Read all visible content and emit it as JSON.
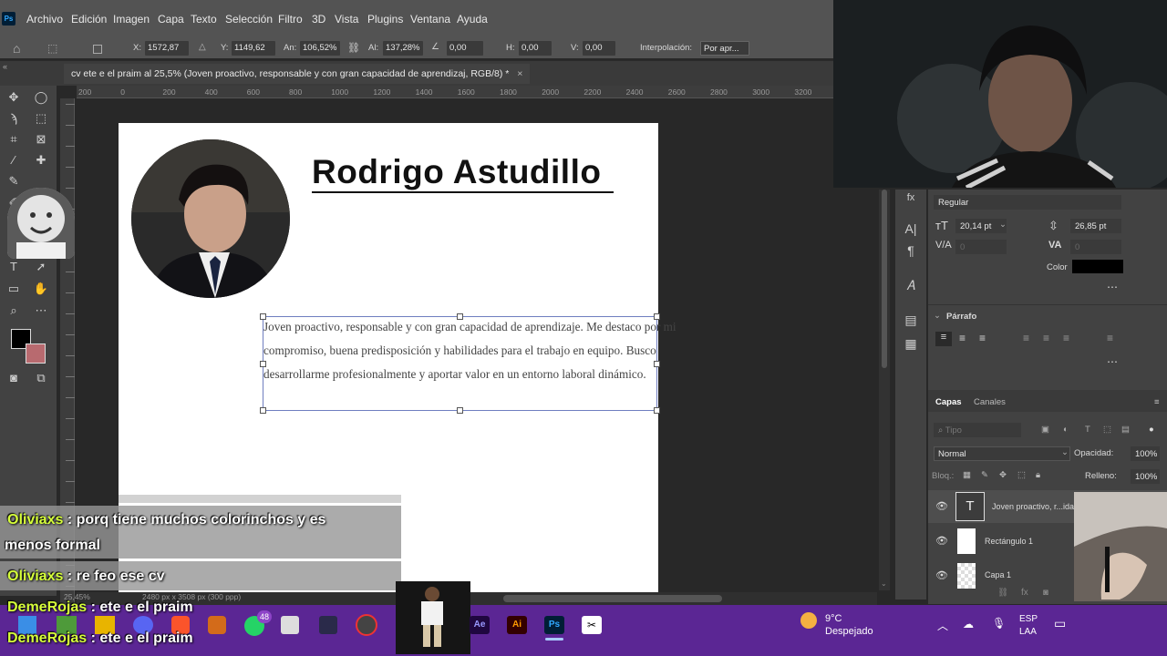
{
  "menubar": {
    "items": [
      "Archivo",
      "Edición",
      "Imagen",
      "Capa",
      "Texto",
      "Selección",
      "Filtro",
      "3D",
      "Vista",
      "Plugins",
      "Ventana",
      "Ayuda"
    ]
  },
  "options": {
    "x_label": "X:",
    "x_value": "1572,87 p:",
    "y_label": "Y:",
    "y_value": "1149,62 p:",
    "w_label": "An:",
    "w_value": "106,52%",
    "h_label": "Al:",
    "h_value": "137,28%",
    "angle_value": "0,00",
    "hskew_label": "H:",
    "hskew_value": "0,00",
    "vskew_label": "V:",
    "vskew_value": "0,00",
    "interp_label": "Interpolación:",
    "interp_value": "Por apr..."
  },
  "document": {
    "tab_title": "cv ete e el praim al 25,5% (Joven proactivo, responsable y con gran capacidad de aprendizaj, RGB/8) *",
    "zoom": "25,45%",
    "size": "2480 px x 3508 px (300 ppp)"
  },
  "ruler": {
    "ticks": [
      "200",
      "0",
      "200",
      "400",
      "600",
      "800",
      "1000",
      "1200",
      "1400",
      "1600",
      "1800",
      "2000",
      "2200",
      "2400",
      "2600",
      "2800",
      "3000",
      "3200"
    ]
  },
  "cv": {
    "name": "Rodrigo Astudillo",
    "lines": [
      "Joven proactivo, responsable y con gran capacidad de aprendizaje. Me destaco por mi",
      "compromiso, buena predisposición y habilidades para el trabajo en equipo. Busco",
      "desarrollarme profesionalmente y aportar valor en un entorno laboral dinámico."
    ]
  },
  "character": {
    "style": "Regular",
    "size": "20,14 pt",
    "leading": "26,85 pt",
    "kerning": "0",
    "tracking": "0",
    "color_label": "Color",
    "color": "#000000"
  },
  "paragraph": {
    "title": "Párrafo"
  },
  "layers": {
    "tab_layers": "Capas",
    "tab_channels": "Canales",
    "search_placeholder": "Tipo",
    "blend_mode": "Normal",
    "opacity_label": "Opacidad:",
    "opacity_value": "100%",
    "lock_label": "Bloq.:",
    "fill_label": "Relleno:",
    "fill_value": "100%",
    "items": [
      {
        "name": "Joven proactivo, r...ida"
      },
      {
        "name": "Rectángulo 1"
      },
      {
        "name": "Capa 1"
      }
    ]
  },
  "chat": {
    "messages": [
      {
        "user": "Oliviaxs",
        "text": " : porq tiene muchos colorinchos y es",
        "cont": "menos formal"
      },
      {
        "user": "Oliviaxs",
        "text": " : re feo ese cv"
      },
      {
        "user": "DemeRojas",
        "text": " : ete e el praim"
      },
      {
        "user": "DemeRojas",
        "text": " : ete e el praim"
      }
    ]
  },
  "taskbar": {
    "notification_count": "48",
    "weather_temp": "9°C",
    "weather_desc": "Despejado",
    "lang_top": "ESP",
    "lang_bottom": "LAA",
    "apps": [
      "Ae",
      "Ai",
      "Ps"
    ]
  },
  "colors": {
    "ps_bg": "#282828",
    "taskbar": "#5b2694",
    "chat_name": "#d6ff3a"
  }
}
